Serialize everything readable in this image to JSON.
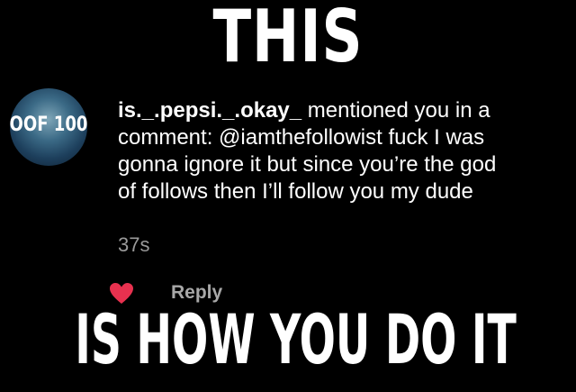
{
  "meme": {
    "top_caption": "THIS",
    "bottom_caption": "IS HOW YOU DO IT"
  },
  "notification": {
    "avatar_text": "OOF 100",
    "username": "is._.pepsi._.okay_",
    "line1_rest": " mentioned you in a",
    "line2": "comment: @iamthefollowist fuck I was",
    "line3": "gonna ignore it but since you’re the god",
    "line4": "of follows then I’ll follow you my dude",
    "timestamp": "37s",
    "reply_label": "Reply",
    "like_icon": "heart-icon",
    "like_color": "#e8314f"
  }
}
